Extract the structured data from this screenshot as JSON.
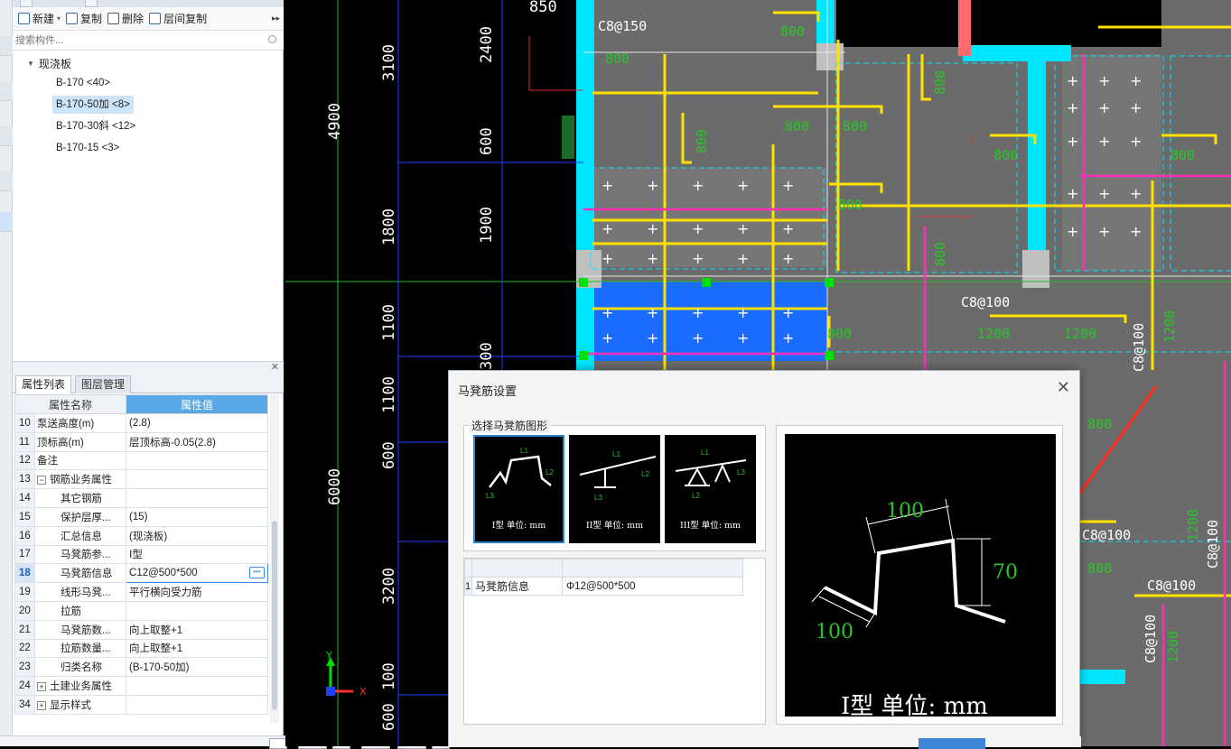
{
  "toolbar": {
    "new_label": "新建",
    "copy_label": "复制",
    "delete_label": "删除",
    "floor_copy_label": "层间复制"
  },
  "search": {
    "placeholder": "搜索构件..."
  },
  "tree": {
    "root_label": "现浇板",
    "items": [
      {
        "label": "B-170 <40>",
        "selected": false
      },
      {
        "label": "B-170-50加 <8>",
        "selected": true
      },
      {
        "label": "B-170-30斜 <12>",
        "selected": false
      },
      {
        "label": "B-170-15 <3>",
        "selected": false
      }
    ]
  },
  "props": {
    "tab_active": "属性列表",
    "tab_inactive": "图层管理",
    "col_name": "属性名称",
    "col_value": "属性值",
    "rows": [
      {
        "num": "10",
        "name": "泵送高度(m)",
        "value": "(2.8)"
      },
      {
        "num": "11",
        "name": "顶标高(m)",
        "value": "层顶标高-0.05(2.8)"
      },
      {
        "num": "12",
        "name": "备注",
        "value": ""
      },
      {
        "num": "13",
        "name": "钢筋业务属性",
        "value": ""
      },
      {
        "num": "14",
        "name": "其它钢筋",
        "value": ""
      },
      {
        "num": "15",
        "name": "保护层厚...",
        "value": "(15)"
      },
      {
        "num": "16",
        "name": "汇总信息",
        "value": "(现浇板)"
      },
      {
        "num": "17",
        "name": "马凳筋参...",
        "value": "Ⅰ型"
      },
      {
        "num": "18",
        "name": "马凳筋信息",
        "value": "C12@500*500"
      },
      {
        "num": "19",
        "name": "线形马凳...",
        "value": "平行横向受力筋"
      },
      {
        "num": "20",
        "name": "拉筋",
        "value": ""
      },
      {
        "num": "21",
        "name": "马凳筋数...",
        "value": "向上取整+1"
      },
      {
        "num": "22",
        "name": "拉筋数量...",
        "value": "向上取整+1"
      },
      {
        "num": "23",
        "name": "归类名称",
        "value": "(B-170-50加)"
      },
      {
        "num": "24",
        "name": "土建业务属性",
        "value": ""
      },
      {
        "num": "34",
        "name": "显示样式",
        "value": ""
      }
    ]
  },
  "cad": {
    "dims_left": [
      "3100",
      "4900",
      "1800",
      "1100",
      "1100",
      "6000",
      "600",
      "3200",
      "100",
      "600"
    ],
    "dims_mid": [
      "850",
      "2400",
      "600",
      "1900",
      "300"
    ],
    "rebar_labels": [
      "C8@150",
      "800",
      "800",
      "800",
      "800",
      "800",
      "800",
      "800",
      "800",
      "800",
      "800",
      "800",
      "C8@100",
      "1200",
      "1200",
      "C8@100",
      "1200",
      "C8@100",
      "C8@100",
      "C8@100",
      "C8@100",
      "1200",
      "800",
      "1200",
      "800"
    ],
    "axis_x": "X",
    "axis_y": "Y",
    "colors": {
      "beam": "#00e5ff",
      "rebar": "#ffe100",
      "rebar_alt": "#ff2fb4",
      "slab": "#6b6b6b",
      "slab_sel": "#1a6cff",
      "dim": "#2040ff",
      "text": "#ffffff",
      "label": "#27c627"
    }
  },
  "dialog": {
    "title": "马凳筋设置",
    "group_label": "选择马凳筋图形",
    "shapes": [
      {
        "caption": "I型 单位: mm",
        "selected": true
      },
      {
        "caption": "II型 单位: mm",
        "selected": false
      },
      {
        "caption": "III型 单位: mm",
        "selected": false
      }
    ],
    "table": {
      "row_num": "1",
      "name": "马凳筋信息",
      "value": "Φ12@500*500"
    },
    "preview": {
      "dim_top": "100",
      "dim_right": "70",
      "dim_left": "100",
      "caption": "I型 单位: mm",
      "L1": "L1",
      "L2": "L2",
      "L3": "L3"
    }
  }
}
